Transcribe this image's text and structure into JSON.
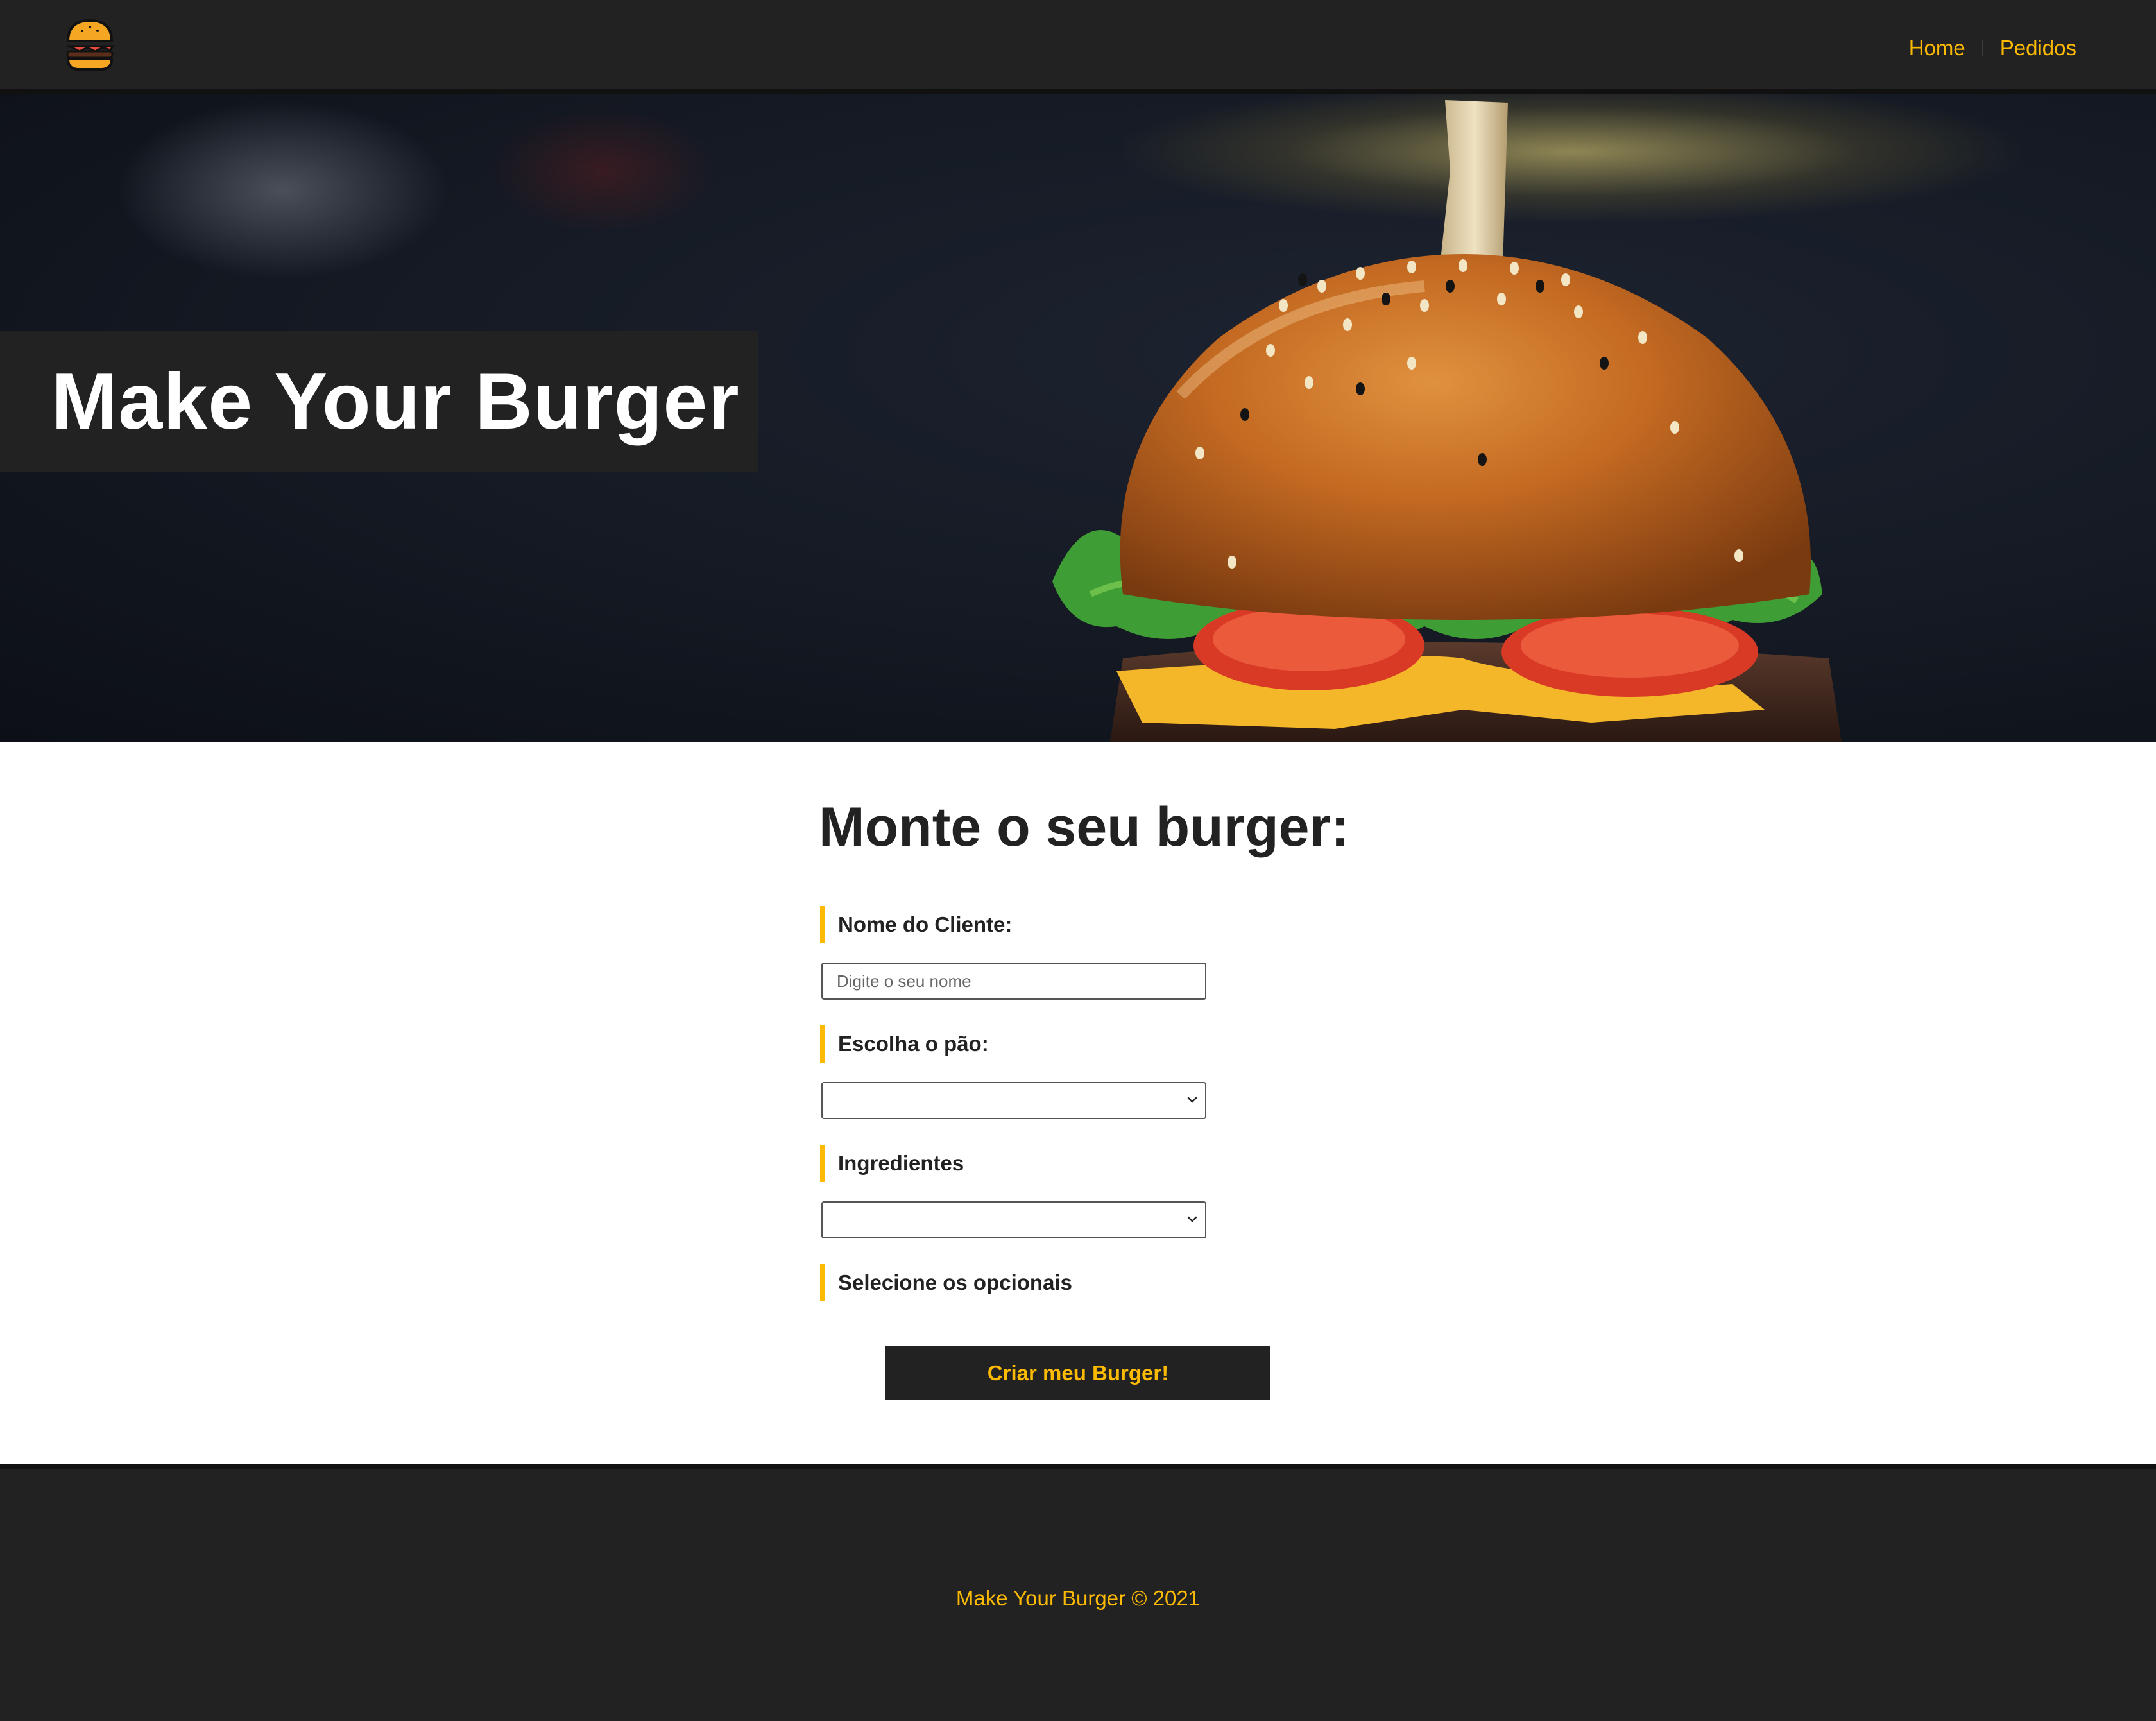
{
  "navbar": {
    "logo_icon": "burger-icon",
    "links": [
      {
        "label": "Home"
      },
      {
        "label": "Pedidos"
      }
    ],
    "link_color": "#fcba03"
  },
  "hero": {
    "title": "Make Your Burger"
  },
  "form": {
    "title": "Monte o seu burger:",
    "name_label": "Nome do Cliente:",
    "name_placeholder": "Digite o seu nome",
    "name_value": "",
    "bread_label": "Escolha o pão:",
    "bread_selected": "",
    "ingredients_label": "Ingredientes",
    "ingredients_selected": "",
    "optionals_label": "Selecione os opcionais",
    "submit_label": "Criar meu Burger!"
  },
  "footer": {
    "text": "Make Your Burger © 2021"
  },
  "colors": {
    "accent": "#fcba03",
    "dark": "#222222",
    "white": "#ffffff"
  }
}
